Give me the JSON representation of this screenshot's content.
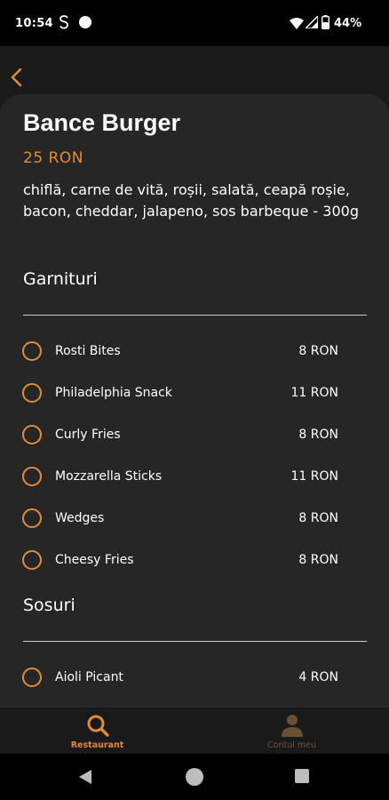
{
  "status_bar": {
    "time": "10:54",
    "battery": "44%"
  },
  "product": {
    "name": "Bance Burger",
    "price": "25 RON",
    "description": "chiflă, carne de vită, roșii, salată, ceapă roșie, bacon, cheddar, jalapeno, sos barbeque - 300g"
  },
  "sections": [
    {
      "title": "Garnituri",
      "options": [
        {
          "name": "Rosti Bites",
          "price": "8 RON"
        },
        {
          "name": "Philadelphia Snack",
          "price": "11 RON"
        },
        {
          "name": "Curly Fries",
          "price": "8 RON"
        },
        {
          "name": "Mozzarella Sticks",
          "price": "11 RON"
        },
        {
          "name": "Wedges",
          "price": "8 RON"
        },
        {
          "name": "Cheesy Fries",
          "price": "8 RON"
        }
      ]
    },
    {
      "title": "Sosuri",
      "options": [
        {
          "name": "Aioli Picant",
          "price": "4 RON"
        }
      ]
    }
  ],
  "bottom_nav": {
    "tabs": [
      {
        "label": "Restaurant",
        "icon": "search-icon",
        "active": true
      },
      {
        "label": "Contul meu",
        "icon": "person-icon",
        "active": false
      }
    ]
  },
  "colors": {
    "accent": "#e08b3a",
    "background": "#1b1b1b",
    "sheet": "#262626"
  }
}
